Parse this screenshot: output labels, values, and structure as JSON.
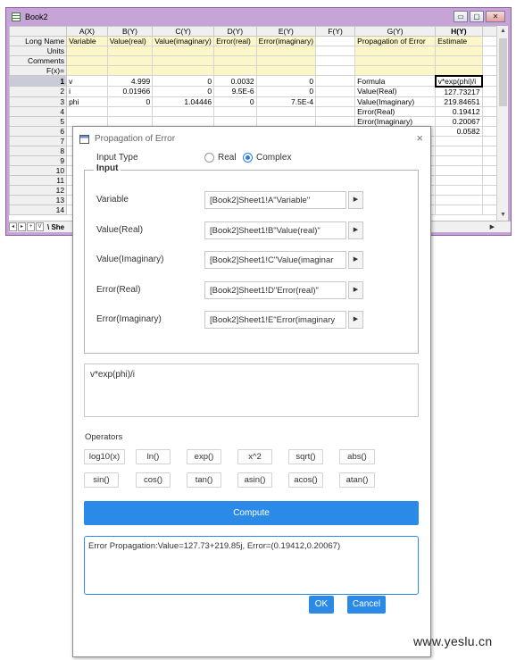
{
  "workbook": {
    "title": "Book2",
    "window_buttons": [
      "▭",
      "▢",
      "✕"
    ],
    "columns": [
      "A(X)",
      "B(Y)",
      "C(Y)",
      "D(Y)",
      "E(Y)",
      "F(Y)",
      "G(Y)",
      "H(Y)"
    ],
    "label_rows": [
      {
        "name": "Long Name",
        "cells": [
          "Variable",
          "Value(real)",
          "Value(imaginary)",
          "Error(real)",
          "Error(imaginary)",
          "",
          "Propagation of Error",
          "Estimate"
        ]
      },
      {
        "name": "Units",
        "cells": [
          "",
          "",
          "",
          "",
          "",
          "",
          "",
          ""
        ]
      },
      {
        "name": "Comments",
        "cells": [
          "",
          "",
          "",
          "",
          "",
          "",
          "",
          ""
        ]
      },
      {
        "name": "F(x)=",
        "cells": [
          "",
          "",
          "",
          "",
          "",
          "",
          "",
          ""
        ]
      }
    ],
    "data_rows": [
      {
        "n": "1",
        "cells": [
          "v",
          "4.999",
          "0",
          "0.0032",
          "0",
          "",
          "Formula",
          "v*exp(phi)/i"
        ]
      },
      {
        "n": "2",
        "cells": [
          "i",
          "0.01966",
          "0",
          "9.5E-6",
          "0",
          "",
          "Value(Real)",
          "127.73217"
        ]
      },
      {
        "n": "3",
        "cells": [
          "phi",
          "0",
          "1.04446",
          "0",
          "7.5E-4",
          "",
          "Value(Imaginary)",
          "219.84651"
        ]
      },
      {
        "n": "4",
        "cells": [
          "",
          "",
          "",
          "",
          "",
          "",
          "Error(Real)",
          "0.19412"
        ]
      },
      {
        "n": "5",
        "cells": [
          "",
          "",
          "",
          "",
          "",
          "",
          "Error(Imaginary)",
          "0.20067"
        ]
      },
      {
        "n": "6",
        "cells": [
          "",
          "",
          "",
          "",
          "",
          "",
          "",
          "0.0582"
        ]
      },
      {
        "n": "7",
        "cells": [
          "",
          "",
          "",
          "",
          "",
          "",
          "",
          ""
        ]
      },
      {
        "n": "8",
        "cells": [
          "",
          "",
          "",
          "",
          "",
          "",
          "",
          ""
        ]
      },
      {
        "n": "9",
        "cells": [
          "",
          "",
          "",
          "",
          "",
          "",
          "",
          ""
        ]
      },
      {
        "n": "10",
        "cells": [
          "",
          "",
          "",
          "",
          "",
          "",
          "",
          ""
        ]
      },
      {
        "n": "11",
        "cells": [
          "",
          "",
          "",
          "",
          "",
          "",
          "",
          ""
        ]
      },
      {
        "n": "12",
        "cells": [
          "",
          "",
          "",
          "",
          "",
          "",
          "",
          ""
        ]
      },
      {
        "n": "13",
        "cells": [
          "",
          "",
          "",
          "",
          "",
          "",
          "",
          ""
        ]
      },
      {
        "n": "14",
        "cells": [
          "",
          "",
          "",
          "",
          "",
          "",
          "",
          ""
        ]
      }
    ],
    "tab_nav": [
      "◂",
      "▸",
      "+",
      "V"
    ],
    "sheet_tab": "\\ She"
  },
  "dialog": {
    "title": "Propagation of Error",
    "close": "×",
    "input_type_label": "Input Type",
    "radio_real": "Real",
    "radio_complex": "Complex",
    "selected": "Complex",
    "group_title": "Input",
    "fields": [
      {
        "label": "Variable",
        "value": "[Book2]Sheet1!A\"Variable\""
      },
      {
        "label": "Value(Real)",
        "value": "[Book2]Sheet1!B\"Value(real)\""
      },
      {
        "label": "Value(Imaginary)",
        "value": "[Book2]Sheet1!C\"Value(imaginar"
      },
      {
        "label": "Error(Real)",
        "value": "[Book2]Sheet1!D\"Error(real)\""
      },
      {
        "label": "Error(Imaginary)",
        "value": "[Book2]Sheet1!E\"Error(imaginary"
      }
    ],
    "field_button": "▶",
    "formula": "v*exp(phi)/i",
    "operators_label": "Operators",
    "operators": [
      "log10(x)",
      "ln()",
      "exp()",
      "x^2",
      "sqrt()",
      "abs()",
      "sin()",
      "cos()",
      "tan()",
      "asin()",
      "acos()",
      "atan()"
    ],
    "compute_label": "Compute",
    "result": "Error Propagation:Value=127.73+219.85j, Error=(0.19412,0.20067)",
    "ok_label": "OK",
    "cancel_label": "Cancel"
  },
  "watermark": "www.yeslu.cn",
  "colors": {
    "accent": "#2b8ae8",
    "window_frame": "#c6a4d6",
    "label_row_bg": "#fbf7c8"
  }
}
